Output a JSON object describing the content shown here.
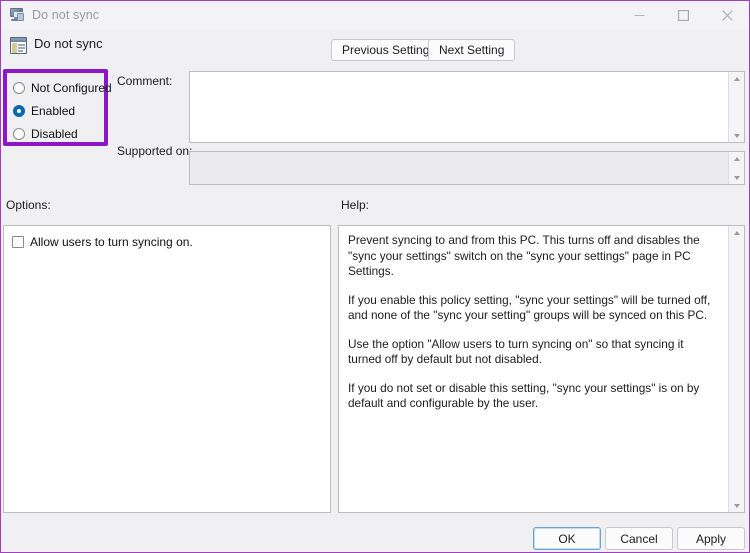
{
  "window": {
    "title": "Do not sync",
    "title_icon": "computer-monitor-icon",
    "controls": {
      "minimize": "minimize-icon",
      "maximize": "maximize-icon",
      "close": "close-icon"
    }
  },
  "header": {
    "policy_icon": "group-policy-setting-icon",
    "policy_name": "Do not sync",
    "previous_setting_label": "Previous Setting",
    "next_setting_label": "Next Setting"
  },
  "state": {
    "highlight_color": "#8a18c8",
    "selected": "Enabled",
    "options": [
      {
        "label": "Not Configured",
        "checked": false
      },
      {
        "label": "Enabled",
        "checked": true
      },
      {
        "label": "Disabled",
        "checked": false
      }
    ]
  },
  "comment": {
    "label": "Comment:",
    "value": "",
    "placeholder": ""
  },
  "supported_on": {
    "label": "Supported on:",
    "value": "",
    "placeholder": ""
  },
  "options_panel": {
    "label": "Options:",
    "checkboxes": [
      {
        "label": "Allow users to turn syncing on.",
        "checked": false
      }
    ]
  },
  "help_panel": {
    "label": "Help:",
    "paragraphs": [
      "Prevent syncing to and from this PC.  This turns off and disables the \"sync your settings\" switch on the \"sync your settings\" page in PC Settings.",
      "If you enable this policy setting, \"sync your settings\" will be turned off, and none of the \"sync your setting\" groups will be synced on this PC.",
      "Use the option \"Allow users to turn syncing on\" so that syncing it turned off by default but not disabled.",
      "If you do not set or disable this setting, \"sync your settings\" is on by default and configurable by the user."
    ]
  },
  "footer": {
    "ok_label": "OK",
    "cancel_label": "Cancel",
    "apply_label": "Apply"
  }
}
